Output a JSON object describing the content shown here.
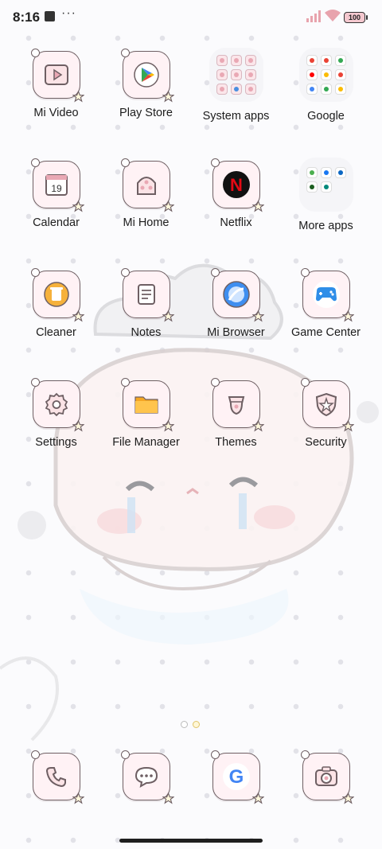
{
  "status_bar": {
    "time": "8:16",
    "more_indicator": "···",
    "battery": "100",
    "icons": [
      "notification-square-icon",
      "signal-icon",
      "wifi-icon",
      "battery-icon"
    ]
  },
  "apps": [
    {
      "label": "Mi Video",
      "icon": "mi-video-icon"
    },
    {
      "label": "Play Store",
      "icon": "play-store-icon"
    },
    {
      "label": "System apps",
      "icon": "folder-icon"
    },
    {
      "label": "Google",
      "icon": "folder-icon"
    },
    {
      "label": "Calendar",
      "icon": "calendar-icon",
      "date": "19"
    },
    {
      "label": "Mi Home",
      "icon": "mi-home-icon"
    },
    {
      "label": "Netflix",
      "icon": "netflix-icon",
      "glyph": "N"
    },
    {
      "label": "More apps",
      "icon": "folder-icon"
    },
    {
      "label": "Cleaner",
      "icon": "cleaner-icon"
    },
    {
      "label": "Notes",
      "icon": "notes-icon"
    },
    {
      "label": "Mi Browser",
      "icon": "browser-icon"
    },
    {
      "label": "Game Center",
      "icon": "gamepad-icon"
    },
    {
      "label": "Settings",
      "icon": "gear-icon"
    },
    {
      "label": "File Manager",
      "icon": "file-folder-icon"
    },
    {
      "label": "Themes",
      "icon": "themes-icon"
    },
    {
      "label": "Security",
      "icon": "shield-icon"
    }
  ],
  "dock": [
    {
      "icon": "phone-icon"
    },
    {
      "icon": "messages-icon"
    },
    {
      "icon": "google-icon",
      "glyph": "G"
    },
    {
      "icon": "camera-icon"
    }
  ],
  "page_indicator": {
    "pages": 2,
    "current": 2
  },
  "colors": {
    "tile_bg": "#fff2f5",
    "tile_border": "#6e5f63",
    "netflix_red": "#e50914",
    "folder_bg": "#f4f4f7"
  }
}
